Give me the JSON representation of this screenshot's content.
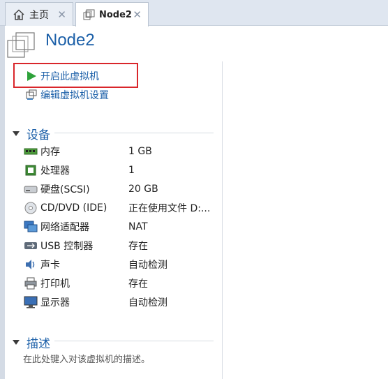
{
  "tabs": [
    {
      "label": "主页",
      "icon": "home-icon"
    },
    {
      "label": "Node2",
      "icon": "vm-icon"
    }
  ],
  "vm": {
    "title": "Node2"
  },
  "actions": {
    "power_on": "开启此虚拟机",
    "edit_settings": "编辑虚拟机设置"
  },
  "devices_section": {
    "title": "设备",
    "items": [
      {
        "name": "内存",
        "value": "1 GB",
        "icon": "memory-icon"
      },
      {
        "name": "处理器",
        "value": "1",
        "icon": "cpu-icon"
      },
      {
        "name": "硬盘(SCSI)",
        "value": "20 GB",
        "icon": "harddisk-icon"
      },
      {
        "name": "CD/DVD (IDE)",
        "value": "正在使用文件 D:...",
        "icon": "cd-icon"
      },
      {
        "name": "网络适配器",
        "value": "NAT",
        "icon": "network-icon"
      },
      {
        "name": "USB 控制器",
        "value": "存在",
        "icon": "usb-icon"
      },
      {
        "name": "声卡",
        "value": "自动检测",
        "icon": "sound-icon"
      },
      {
        "name": "打印机",
        "value": "存在",
        "icon": "printer-icon"
      },
      {
        "name": "显示器",
        "value": "自动检测",
        "icon": "display-icon"
      }
    ]
  },
  "description_section": {
    "title": "描述",
    "placeholder": "在此处键入对该虚拟机的描述。"
  },
  "colors": {
    "accent": "#1b5fa8",
    "highlight": "#d9262b",
    "play": "#2ea23a"
  }
}
